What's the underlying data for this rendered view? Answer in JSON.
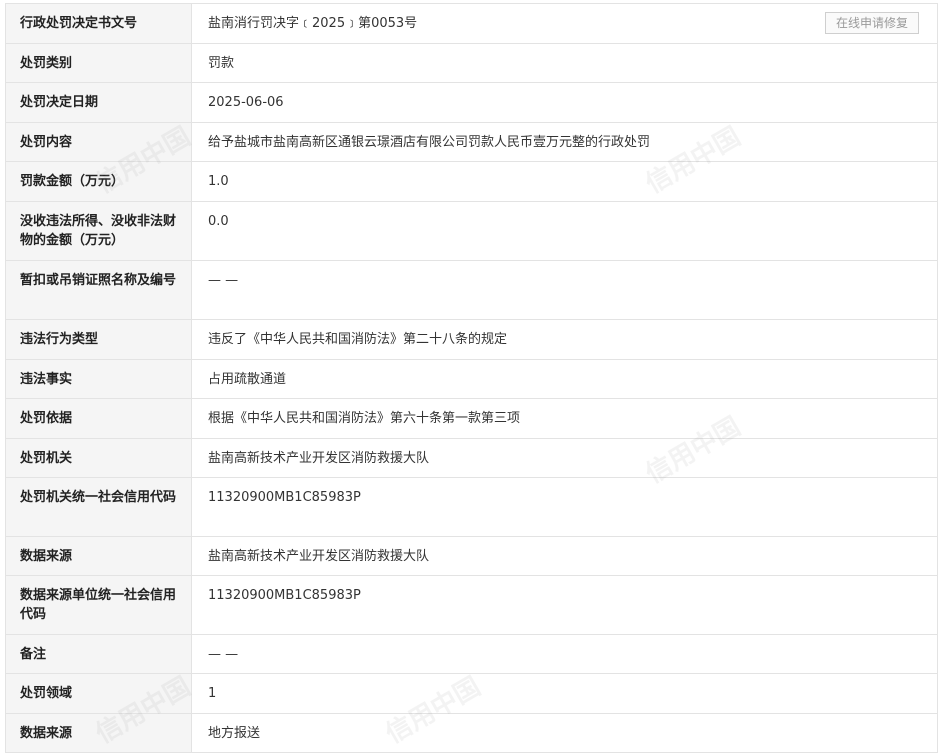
{
  "repair_button_label": "在线申请修复",
  "watermark_text": "信用中国",
  "rows": [
    {
      "label": "行政处罚决定书文号",
      "value": "盐南消行罚决字﹝2025﹞第0053号"
    },
    {
      "label": "处罚类别",
      "value": "罚款"
    },
    {
      "label": "处罚决定日期",
      "value": "2025-06-06"
    },
    {
      "label": "处罚内容",
      "value": "给予盐城市盐南高新区通银云璟酒店有限公司罚款人民币壹万元整的行政处罚"
    },
    {
      "label": "罚款金额（万元）",
      "value": "1.0"
    },
    {
      "label": "没收违法所得、没收非法财物的金额（万元）",
      "value": "0.0"
    },
    {
      "label": "暂扣或吊销证照名称及编号",
      "value": "— —"
    },
    {
      "label": "违法行为类型",
      "value": "违反了《中华人民共和国消防法》第二十八条的规定"
    },
    {
      "label": "违法事实",
      "value": "占用疏散通道"
    },
    {
      "label": "处罚依据",
      "value": "根据《中华人民共和国消防法》第六十条第一款第三项"
    },
    {
      "label": "处罚机关",
      "value": "盐南高新技术产业开发区消防救援大队"
    },
    {
      "label": "处罚机关统一社会信用代码",
      "value": "11320900MB1C85983P"
    },
    {
      "label": "数据来源",
      "value": "盐南高新技术产业开发区消防救援大队"
    },
    {
      "label": "数据来源单位统一社会信用代码",
      "value": "11320900MB1C85983P"
    },
    {
      "label": "备注",
      "value": "— —"
    },
    {
      "label": "处罚领域",
      "value": "1"
    },
    {
      "label": "数据来源",
      "value": "地方报送"
    }
  ]
}
